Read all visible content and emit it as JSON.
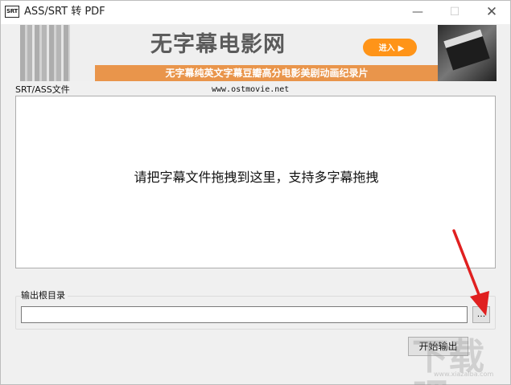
{
  "window": {
    "title": "ASS/SRT 转 PDF",
    "icon_text": "SRT",
    "minimize_glyph": "—",
    "maximize_glyph": "☐",
    "close_glyph": "✕"
  },
  "banner": {
    "logo": "无字幕电影网",
    "enter_label": "进入",
    "enter_arrow": "▶",
    "slogan": "无字幕纯英文字幕豆瓣高分电影美剧动画纪录片",
    "url": "www.ostmovie.net"
  },
  "file_group": {
    "label": "SRT/ASS文件",
    "drop_hint": "请把字幕文件拖拽到这里，支持多字幕拖拽"
  },
  "output_group": {
    "label": "输出根目录",
    "value": "",
    "browse_label": "..."
  },
  "actions": {
    "start_label": "开始输出"
  },
  "watermark": {
    "text": "下载吧",
    "small_text": "www.xiazaiba.com"
  },
  "colors": {
    "accent_orange": "#ff9418",
    "slogan_orange": "#e9954b",
    "annotation_arrow": "#e02020"
  }
}
